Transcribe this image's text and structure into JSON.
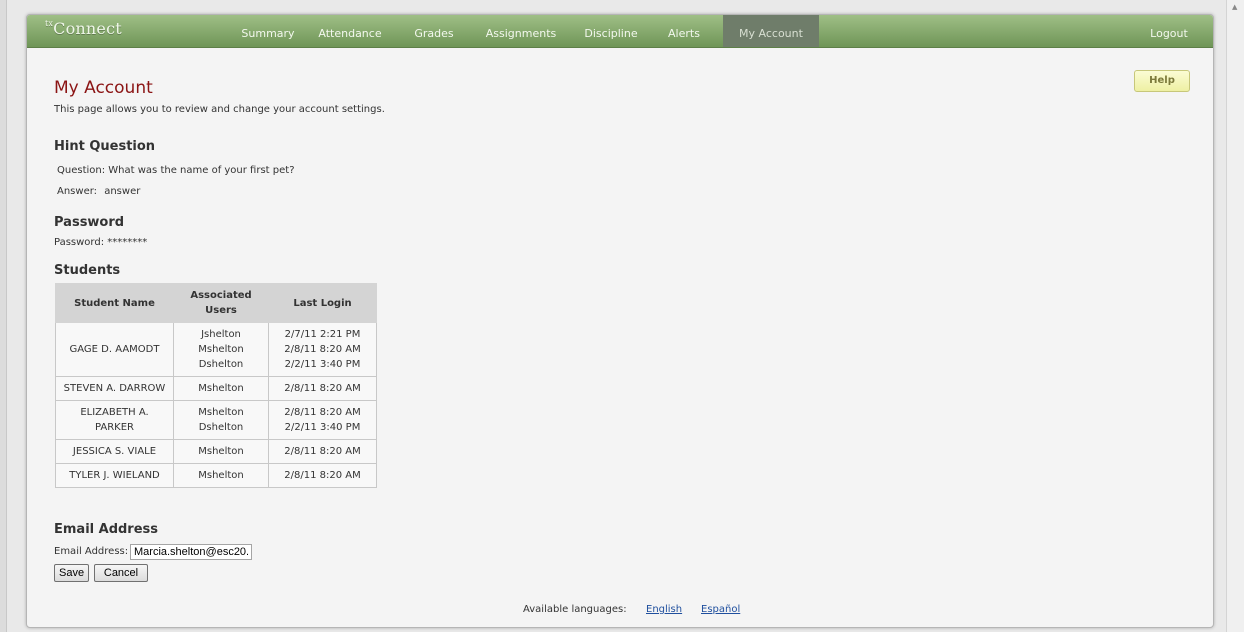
{
  "app": {
    "logo_prefix": "tx",
    "logo_name": "Connect"
  },
  "nav": {
    "items": [
      {
        "label": "Summary"
      },
      {
        "label": "Attendance"
      },
      {
        "label": "Grades"
      },
      {
        "label": "Assignments"
      },
      {
        "label": "Discipline"
      },
      {
        "label": "Alerts"
      },
      {
        "label": "My Account",
        "active": true
      }
    ],
    "logout": "Logout"
  },
  "help_label": "Help",
  "page": {
    "title": "My Account",
    "description": "This page allows you to review and change your account settings."
  },
  "hint": {
    "heading": "Hint Question",
    "question_label": "Question:",
    "question": "What was the name of your first pet?",
    "answer_label": "Answer:",
    "answer": "answer"
  },
  "password": {
    "heading": "Password",
    "label": "Password:",
    "value": "********"
  },
  "students": {
    "heading": "Students",
    "columns": [
      "Student Name",
      "Associated Users",
      "Last Login"
    ],
    "rows": [
      {
        "name": "GAGE D. AAMODT",
        "users": [
          "Jshelton",
          "Mshelton",
          "Dshelton"
        ],
        "logins": [
          "2/7/11 2:21 PM",
          "2/8/11 8:20 AM",
          "2/2/11 3:40 PM"
        ]
      },
      {
        "name": "STEVEN A. DARROW",
        "users": [
          "Mshelton"
        ],
        "logins": [
          "2/8/11 8:20 AM"
        ]
      },
      {
        "name": "ELIZABETH A. PARKER",
        "users": [
          "Mshelton",
          "Dshelton"
        ],
        "logins": [
          "2/8/11 8:20 AM",
          "2/2/11 3:40 PM"
        ]
      },
      {
        "name": "JESSICA S. VIALE",
        "users": [
          "Mshelton"
        ],
        "logins": [
          "2/8/11 8:20 AM"
        ]
      },
      {
        "name": "TYLER J. WIELAND",
        "users": [
          "Mshelton"
        ],
        "logins": [
          "2/8/11 8:20 AM"
        ]
      }
    ]
  },
  "email": {
    "heading": "Email Address",
    "label": "Email Address:",
    "value": "Marcia.shelton@esc20.",
    "save": "Save",
    "cancel": "Cancel"
  },
  "languages": {
    "label": "Available languages:",
    "english": "English",
    "spanish": "Español"
  },
  "colors": {
    "topbar": "#7fa066",
    "title": "#8b1414",
    "link": "#1f4f9e",
    "active_tab": "#6f7d6a"
  }
}
